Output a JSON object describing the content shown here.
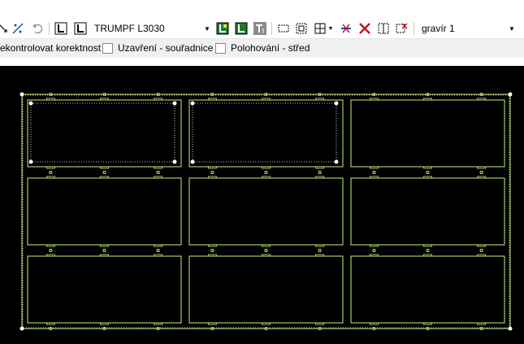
{
  "toolbar": {
    "machine_select": {
      "value": "TRUMPF L3030"
    },
    "layer_select": {
      "value": "gravír 1"
    },
    "icons": [
      "node-tool-icon",
      "snap-tool-icon",
      "undo-icon",
      "corner-left-icon",
      "corner-right-icon",
      "bridge-green-icon",
      "bridge-outline-icon",
      "text-tool-icon",
      "rect-dots-icon",
      "frame-icon",
      "grid-icon",
      "split-icon",
      "mirror-icon",
      "delete-x-icon",
      "array-icon",
      "red-x-icon"
    ]
  },
  "options": {
    "check_label": "ekontrolovat korektnost",
    "closing_label": "Uzavření - souřadnice",
    "closing_checked": false,
    "positioning_label": "Polohování - střed",
    "positioning_checked": false
  },
  "canvas": {
    "background": "#000000",
    "contour_color": "#c8f07a",
    "selection_color": "#ffffff",
    "grid_rows": 3,
    "grid_cols": 3,
    "selected_parts": [
      0,
      1
    ]
  }
}
